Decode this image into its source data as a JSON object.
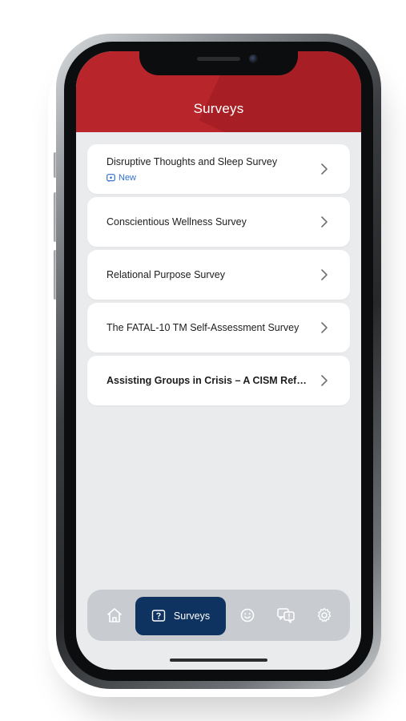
{
  "header": {
    "title": "Surveys"
  },
  "surveys": [
    {
      "title": "Disruptive Thoughts and Sleep Survey",
      "badge": "New"
    },
    {
      "title": "Conscientious Wellness Survey"
    },
    {
      "title": "Relational Purpose Survey"
    },
    {
      "title": "The FATAL-10 TM Self-Assessment Survey"
    },
    {
      "title": "Assisting Groups in Crisis – A CISM Refre..."
    }
  ],
  "tabbar": {
    "active_label": "Surveys",
    "icons": [
      "home-icon",
      "question-square-icon",
      "smiley-icon",
      "chat-bubbles-icon",
      "gear-icon"
    ]
  },
  "colors": {
    "header_red": "#b8252a",
    "active_tab_navy": "#0f3360",
    "badge_blue": "#2f6fd0",
    "screen_background": "#eaebed"
  }
}
